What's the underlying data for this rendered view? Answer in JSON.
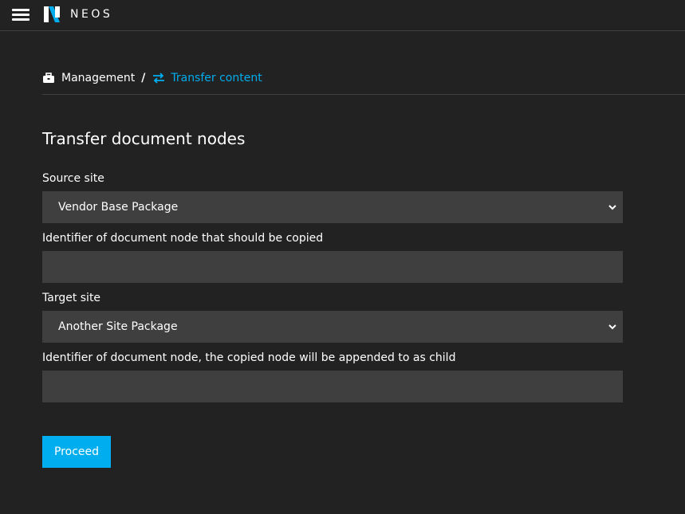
{
  "app": {
    "brand": "NEOS",
    "icons": {
      "menu": "hamburger-icon",
      "logo": "neos-logo-icon"
    },
    "colors": {
      "background": "#222222",
      "field": "#3f3f3f",
      "accent": "#00adee"
    }
  },
  "breadcrumb": {
    "parent": {
      "label": "Management",
      "icon": "briefcase-icon"
    },
    "separator": "/",
    "current": {
      "label": "Transfer content",
      "icon": "exchange-icon"
    }
  },
  "form": {
    "title": "Transfer document nodes",
    "source_site": {
      "label": "Source site",
      "value": "Vendor Base Package"
    },
    "source_node": {
      "label": "Identifier of document node that should be copied",
      "value": "",
      "placeholder": ""
    },
    "target_site": {
      "label": "Target site",
      "value": "Another Site Package"
    },
    "target_node": {
      "label": "Identifier of document node, the copied node will be appended to as child",
      "value": "",
      "placeholder": ""
    },
    "submit_label": "Proceed"
  }
}
